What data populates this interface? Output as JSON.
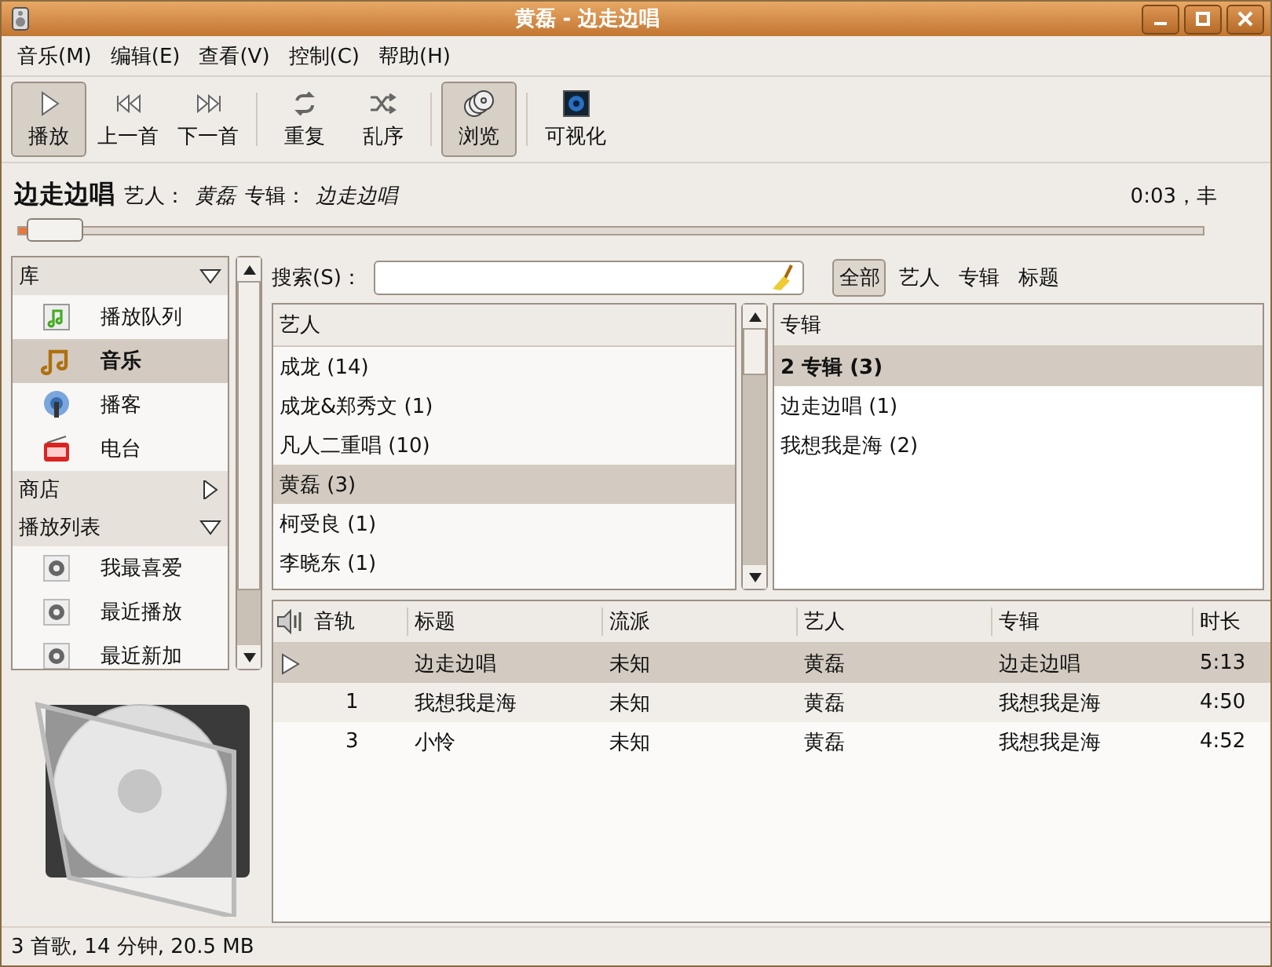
{
  "window": {
    "title": "黄磊 - 边走边唱"
  },
  "menu": [
    "音乐(M)",
    "编辑(E)",
    "查看(V)",
    "控制(C)",
    "帮助(H)"
  ],
  "toolbar": [
    [
      {
        "label": "播放",
        "kind": "play",
        "selected": true
      },
      {
        "label": "上一首",
        "kind": "prev",
        "selected": false
      },
      {
        "label": "下一首",
        "kind": "next",
        "selected": false
      }
    ],
    [
      {
        "label": "重复",
        "kind": "repeat",
        "selected": false
      },
      {
        "label": "乱序",
        "kind": "shuffle",
        "selected": false
      }
    ],
    [
      {
        "label": "浏览",
        "kind": "browse",
        "selected": true
      }
    ],
    [
      {
        "label": "可视化",
        "kind": "visual",
        "selected": false
      }
    ]
  ],
  "now_playing": {
    "title": "边走边唱",
    "artist_label": "艺人：",
    "artist": "黄磊",
    "album_label": "专辑：",
    "album": "边走边唱",
    "time": "0:03，丰",
    "level": 0.01
  },
  "sidebar": [
    {
      "label": "库",
      "expanded": true,
      "items": [
        {
          "label": "播放队列",
          "kind": "queue",
          "selected": false
        },
        {
          "label": "音乐",
          "kind": "music",
          "selected": true
        },
        {
          "label": "播客",
          "kind": "podcast",
          "selected": false
        },
        {
          "label": "电台",
          "kind": "radio",
          "selected": false
        }
      ]
    },
    {
      "label": "商店",
      "expanded": false
    },
    {
      "label": "播放列表",
      "expanded": true,
      "items": [
        {
          "label": "我最喜爱",
          "kind": "playlist",
          "selected": false
        },
        {
          "label": "最近播放",
          "kind": "playlist",
          "selected": false
        },
        {
          "label": "最近新加",
          "kind": "playlist",
          "selected": false
        }
      ]
    }
  ],
  "search": {
    "label": "搜索(S)：",
    "filters": [
      {
        "label": "全部",
        "selected": true
      },
      {
        "label": "艺人",
        "selected": false
      },
      {
        "label": "专辑",
        "selected": false
      },
      {
        "label": "标题",
        "selected": false
      }
    ]
  },
  "artist_pane": {
    "header": "艺人",
    "rows": [
      {
        "label": "成龙 (14)",
        "selected": false
      },
      {
        "label": "成龙&郑秀文 (1)",
        "selected": false
      },
      {
        "label": "凡人二重唱 (10)",
        "selected": false
      },
      {
        "label": "黄磊 (3)",
        "selected": true
      },
      {
        "label": "柯受良 (1)",
        "selected": false
      },
      {
        "label": "李晓东 (1)",
        "selected": false
      }
    ]
  },
  "album_pane": {
    "header": "专辑",
    "rows": [
      {
        "label": "2 专辑 (3)",
        "kind": "summary",
        "selected": true
      },
      {
        "label": "边走边唱 (1)",
        "kind": "album",
        "selected": false
      },
      {
        "label": "我想我是海 (2)",
        "kind": "album",
        "selected": false
      }
    ]
  },
  "tracks": {
    "columns": [
      "音轨",
      "标题",
      "流派",
      "艺人",
      "专辑",
      "时长"
    ],
    "rows": [
      {
        "playing": true,
        "selected": true,
        "cells": [
          "",
          "边走边唱",
          "未知",
          "黄磊",
          "边走边唱",
          "5:13"
        ]
      },
      {
        "playing": false,
        "selected": false,
        "cells": [
          "1",
          "我想我是海",
          "未知",
          "黄磊",
          "我想我是海",
          "4:50"
        ]
      },
      {
        "playing": false,
        "selected": false,
        "cells": [
          "3",
          "小怜",
          "未知",
          "黄磊",
          "我想我是海",
          "4:52"
        ]
      }
    ]
  },
  "status_bar": "3 首歌, 14 分钟, 20.5 MB"
}
